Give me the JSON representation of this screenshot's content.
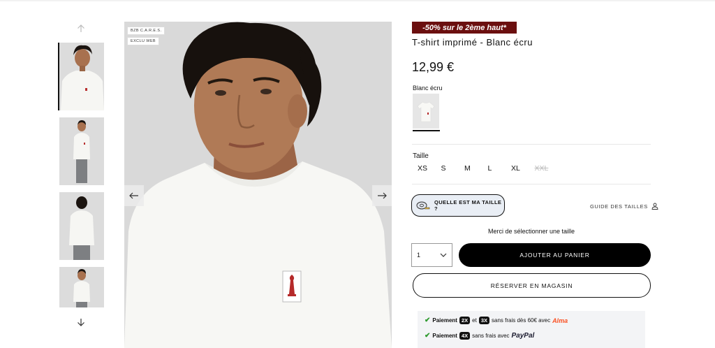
{
  "thumbnails": {
    "items": [
      {
        "alt": "front-portrait"
      },
      {
        "alt": "full-front"
      },
      {
        "alt": "back-view"
      },
      {
        "alt": "full-front-2"
      }
    ]
  },
  "main_image": {
    "badges": [
      "BZB C.A.R.E.S.",
      "EXCLU WEB"
    ]
  },
  "product": {
    "promo": "-50% sur le 2ème haut*",
    "title": "T-shirt imprimé - Blanc écru",
    "price": "12,99 €",
    "color_label": "Blanc écru",
    "size_label": "Taille",
    "sizes": [
      {
        "label": "XS",
        "available": true
      },
      {
        "label": "S",
        "available": true
      },
      {
        "label": "M",
        "available": true
      },
      {
        "label": "L",
        "available": true
      },
      {
        "label": "XL",
        "available": true
      },
      {
        "label": "XXL",
        "available": false
      }
    ],
    "fit_button": "QUELLE EST MA TAILLE ?",
    "size_guide": "GUIDE DES TAILLES",
    "select_message": "Merci de sélectionner une taille",
    "quantity": "1",
    "add_to_cart": "AJOUTER AU PANIER",
    "reserve": "RÉSERVER EN MAGASIN"
  },
  "payment": {
    "line1": {
      "prefix": "Paiement",
      "x2": "2X",
      "and": "et",
      "x3": "3X",
      "text": "sans frais dès 60€ avec",
      "brand": "Alma"
    },
    "line2": {
      "prefix": "Paiement",
      "x4": "4X",
      "text": "sans frais avec",
      "brand": "PayPal"
    }
  },
  "colors": {
    "promo_bg": "#6b0f0f",
    "accent": "#000000",
    "alma": "#fa5022"
  }
}
